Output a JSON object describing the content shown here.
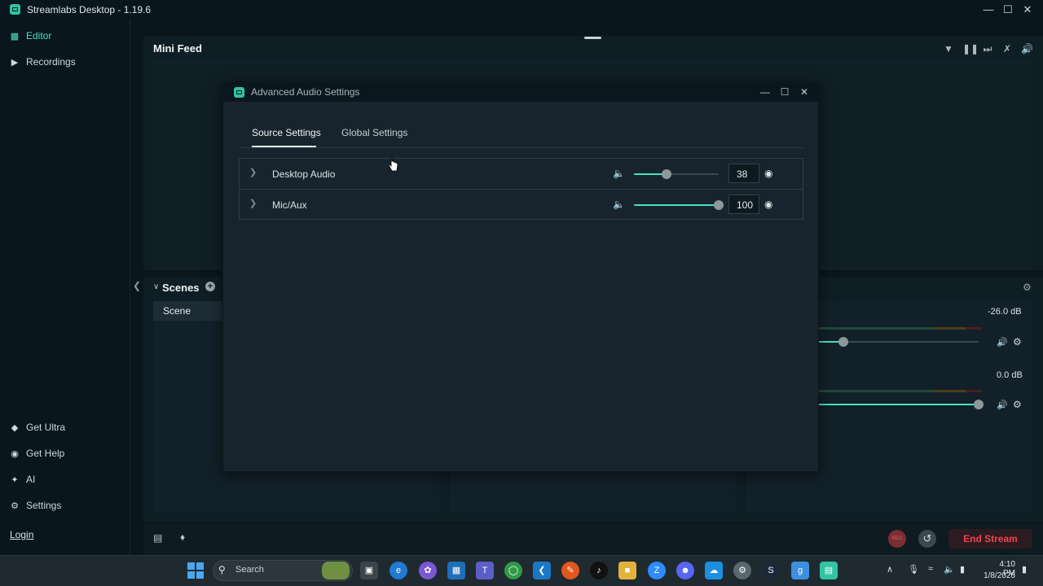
{
  "window": {
    "title": "Streamlabs Desktop - 1.19.6"
  },
  "sidebar": {
    "items": [
      {
        "label": "Editor"
      },
      {
        "label": "Recordings"
      }
    ],
    "bottom_items": [
      {
        "label": "Get Ultra"
      },
      {
        "label": "Get Help"
      },
      {
        "label": "AI"
      },
      {
        "label": "Settings"
      }
    ],
    "login": "Login"
  },
  "mini_feed": {
    "title": "Mini Feed"
  },
  "scenes": {
    "title": "Scenes",
    "items": [
      "Scene"
    ]
  },
  "mixer": {
    "level1": "-26.0 dB",
    "level2": "0.0 dB"
  },
  "bottom_bar": {
    "rec_label": "REC",
    "end_stream": "End Stream"
  },
  "modal": {
    "title": "Advanced Audio Settings",
    "tabs": [
      {
        "label": "Source Settings",
        "active": true
      },
      {
        "label": "Global Settings",
        "active": false
      }
    ],
    "sources": [
      {
        "name": "Desktop Audio",
        "volume": 38,
        "volume_text": "38"
      },
      {
        "name": "Mic/Aux",
        "volume": 100,
        "volume_text": "100"
      }
    ]
  },
  "taskbar": {
    "search_placeholder": "Search",
    "time": "4:10 PM",
    "date": "1/8/2026"
  },
  "colors": {
    "accent": "#49e1bf",
    "background": "#09161d",
    "end_stream": "#f3424e"
  }
}
